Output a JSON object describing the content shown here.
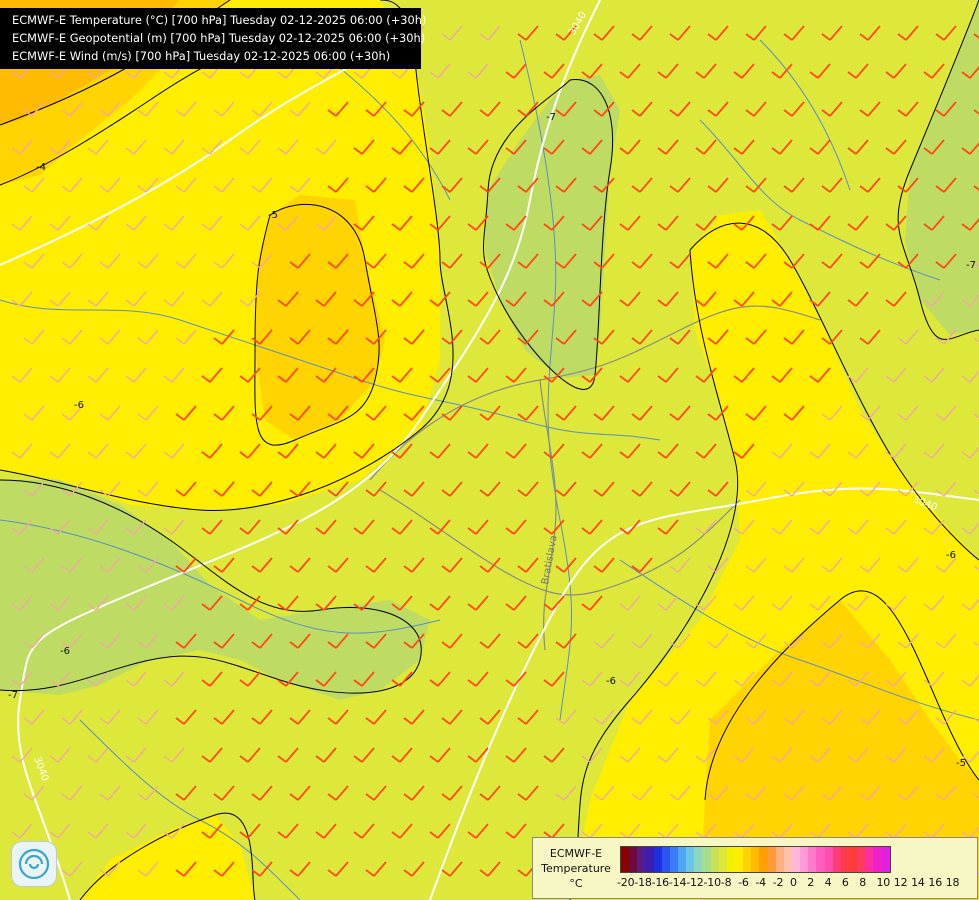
{
  "titles": [
    "ECMWF-E Temperature (°C) [700 hPa] Tuesday 02-12-2025 06:00 (+30h)",
    "ECMWF-E Geopotential (m) [700 hPa] Tuesday 02-12-2025 06:00 (+30h)",
    "ECMWF-E Wind (m/s) [700 hPa] Tuesday 02-12-2025 06:00 (+30h)"
  ],
  "legend": {
    "title_lines": [
      "ECMWF-E",
      "Temperature",
      "°C"
    ],
    "ticks": [
      "-20",
      "-18",
      "-16",
      "-14",
      "-12",
      "-10",
      "-8",
      "-6",
      "-4",
      "-2",
      "0",
      "2",
      "4",
      "6",
      "8",
      "10",
      "12",
      "14",
      "16",
      "18"
    ],
    "swatch_colors": [
      "#8b0000",
      "#6e0a3c",
      "#5a1a8a",
      "#3a1fb0",
      "#1e2ee0",
      "#2a55f0",
      "#3a7cf5",
      "#4fa6f5",
      "#6cc6e8",
      "#8cd7c2",
      "#a8dc8e",
      "#c7e256",
      "#dde83a",
      "#f2f000",
      "#ffee00",
      "#ffd400",
      "#ffbb00",
      "#ffa000",
      "#ff9a3c",
      "#ffb080",
      "#ffc0b0",
      "#ffb6d8",
      "#ff9ad8",
      "#ff7acb",
      "#ff5ec0",
      "#ff4db0",
      "#ff3c7a",
      "#ff3a4a",
      "#ff3a3a",
      "#ff3a5a",
      "#ff2ea0",
      "#f020c8",
      "#e020e0"
    ]
  },
  "map_labels": {
    "temp_contours": [
      "-4",
      "-5",
      "-6",
      "-7",
      "-6",
      "-6",
      "-5",
      "-6",
      "-7",
      "-7"
    ],
    "geopotential_contours": [
      "3040",
      "3040",
      "3040"
    ],
    "place_name": "Bratislava"
  },
  "colors": {
    "base_field": "#dde83a",
    "warm_field": "#ffee00",
    "warmer_field": "#ffd400",
    "warmest_field": "#ffbb00",
    "cold_field": "#bedc64",
    "strong_wind_barb": "#ff4a14",
    "weak_wind_barb": "#f2a8a0",
    "geopotential_line": "#ffffff",
    "isotherm_line": "#000000",
    "river_line": "#5b8fc4",
    "border_line": "#8a8a8a"
  }
}
